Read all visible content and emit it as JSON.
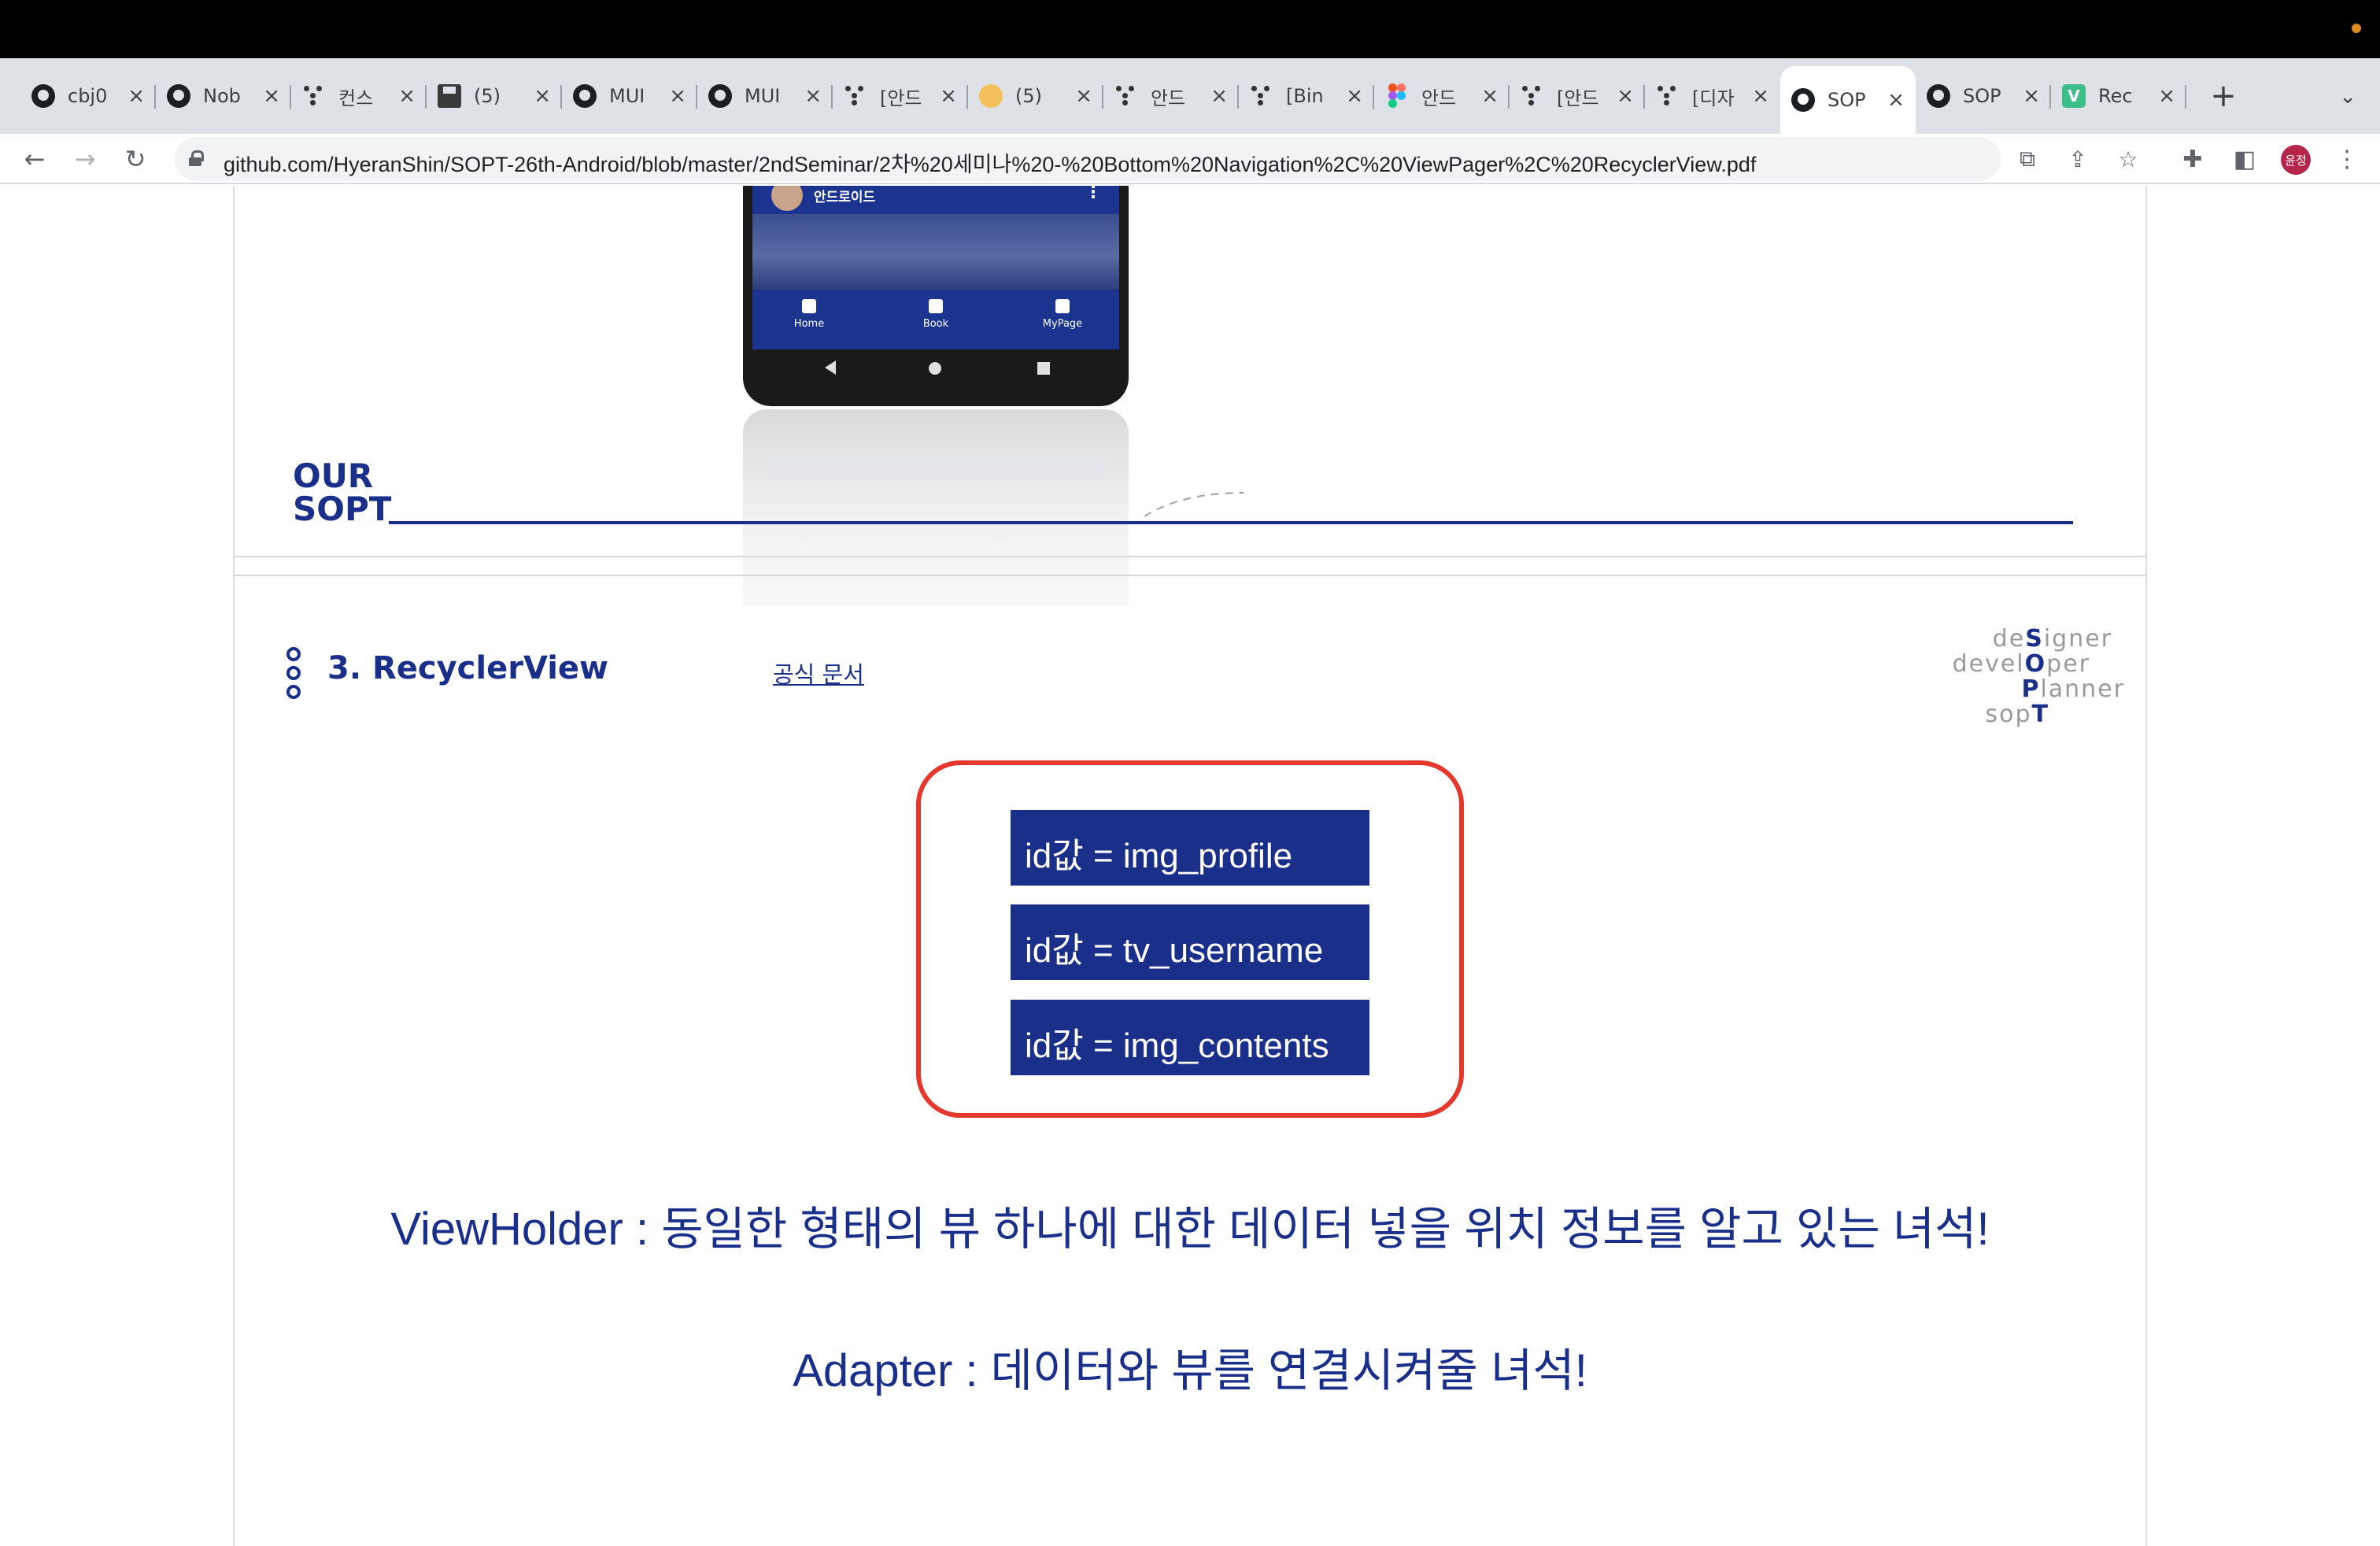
{
  "browser": {
    "tabs": [
      {
        "title": "cbj0",
        "icon": "github-icon"
      },
      {
        "title": "Nob",
        "icon": "github-icon"
      },
      {
        "title": "컨스",
        "icon": "dots-icon"
      },
      {
        "title": "(5) ",
        "icon": "floppy-icon"
      },
      {
        "title": "MUI",
        "icon": "github-icon"
      },
      {
        "title": "MUI",
        "icon": "github-icon"
      },
      {
        "title": "[안드",
        "icon": "dots-icon"
      },
      {
        "title": "(5) ",
        "icon": "avatar-icon"
      },
      {
        "title": "안드",
        "icon": "dots-icon"
      },
      {
        "title": "[Bin",
        "icon": "dots-icon"
      },
      {
        "title": "안드",
        "icon": "figma-icon"
      },
      {
        "title": "[안드",
        "icon": "dots-icon"
      },
      {
        "title": "[디자",
        "icon": "dots-icon"
      },
      {
        "title": "SOP",
        "icon": "github-icon",
        "active": true
      },
      {
        "title": "SOP",
        "icon": "github-icon"
      },
      {
        "title": "Rec",
        "icon": "v-icon"
      }
    ],
    "new_tab_label": "+",
    "url": "github.com/HyeranShin/SOPT-26th-Android/blob/master/2ndSeminar/2차%20세미나%20-%20Bottom%20Navigation%2C%20ViewPager%2C%20RecyclerView.pdf",
    "profile_initials": "윤정"
  },
  "phone": {
    "app_title": "안드로이드",
    "nav": [
      "Home",
      "Book",
      "MyPage"
    ]
  },
  "slide_prev": {
    "brand_line1": "OUR",
    "brand_line2": "SOPT"
  },
  "slide": {
    "title": "3. RecyclerView",
    "link": "공식 문서",
    "brand": [
      "designer",
      "developer",
      "Planner",
      "sopT"
    ],
    "ids": [
      "id값 = img_profile",
      "id값 = tv_username",
      "id값 = img_contents"
    ],
    "viewholder_text": "ViewHolder : 동일한 형태의 뷰 하나에 대한 데이터 넣을 위치 정보를 알고 있는 녀석!",
    "adapter_text": "Adapter : 데이터와 뷰를 연결시켜줄 녀석!"
  },
  "colors": {
    "accent_blue": "#1a2f8a",
    "highlight_red": "#e3382b"
  }
}
